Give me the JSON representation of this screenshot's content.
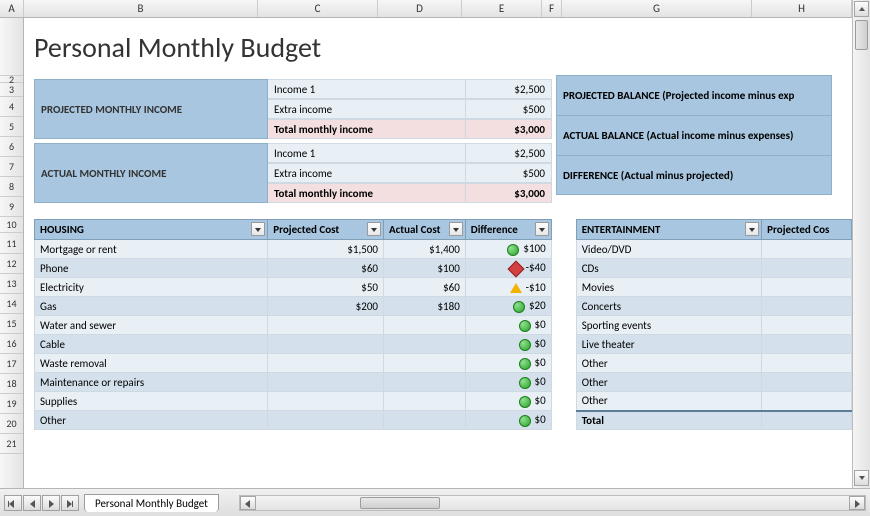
{
  "columns": [
    "A",
    "B",
    "C",
    "D",
    "E",
    "F",
    "G",
    "H"
  ],
  "rows": [
    "",
    "2",
    "3",
    "4",
    "5",
    "6",
    "7",
    "8",
    "9",
    "10",
    "11",
    "12",
    "13",
    "14",
    "15",
    "16",
    "17",
    "18",
    "19",
    "20",
    "21"
  ],
  "title": "Personal Monthly Budget",
  "income": {
    "projected_label": "PROJECTED MONTHLY INCOME",
    "actual_label": "ACTUAL MONTHLY INCOME",
    "projected_rows": [
      {
        "label": "Income 1",
        "value": "$2,500"
      },
      {
        "label": "Extra income",
        "value": "$500"
      },
      {
        "label": "Total monthly income",
        "value": "$3,000",
        "total": true
      }
    ],
    "actual_rows": [
      {
        "label": "Income 1",
        "value": "$2,500"
      },
      {
        "label": "Extra income",
        "value": "$500"
      },
      {
        "label": "Total monthly income",
        "value": "$3,000",
        "total": true
      }
    ]
  },
  "balance": {
    "projected": "PROJECTED BALANCE (Projected income minus exp",
    "actual": "ACTUAL BALANCE (Actual income minus expenses)",
    "difference": "DIFFERENCE (Actual minus projected)"
  },
  "housing": {
    "header": "HOUSING",
    "cols": [
      "Projected Cost",
      "Actual Cost",
      "Difference"
    ],
    "rows": [
      {
        "name": "Mortgage or rent",
        "proj": "$1,500",
        "act": "$1,400",
        "ind": "green",
        "diff": "$100"
      },
      {
        "name": "Phone",
        "proj": "$60",
        "act": "$100",
        "ind": "red",
        "diff": "-$40"
      },
      {
        "name": "Electricity",
        "proj": "$50",
        "act": "$60",
        "ind": "amber",
        "diff": "-$10"
      },
      {
        "name": "Gas",
        "proj": "$200",
        "act": "$180",
        "ind": "green",
        "diff": "$20"
      },
      {
        "name": "Water and sewer",
        "proj": "",
        "act": "",
        "ind": "green",
        "diff": "$0"
      },
      {
        "name": "Cable",
        "proj": "",
        "act": "",
        "ind": "green",
        "diff": "$0"
      },
      {
        "name": "Waste removal",
        "proj": "",
        "act": "",
        "ind": "green",
        "diff": "$0"
      },
      {
        "name": "Maintenance or repairs",
        "proj": "",
        "act": "",
        "ind": "green",
        "diff": "$0"
      },
      {
        "name": "Supplies",
        "proj": "",
        "act": "",
        "ind": "green",
        "diff": "$0"
      },
      {
        "name": "Other",
        "proj": "",
        "act": "",
        "ind": "green",
        "diff": "$0"
      }
    ]
  },
  "entertainment": {
    "header": "ENTERTAINMENT",
    "col2": "Projected Cos",
    "rows": [
      "Video/DVD",
      "CDs",
      "Movies",
      "Concerts",
      "Sporting events",
      "Live theater",
      "Other",
      "Other",
      "Other"
    ],
    "total_label": "Total"
  },
  "sheet_tab": "Personal Monthly Budget"
}
